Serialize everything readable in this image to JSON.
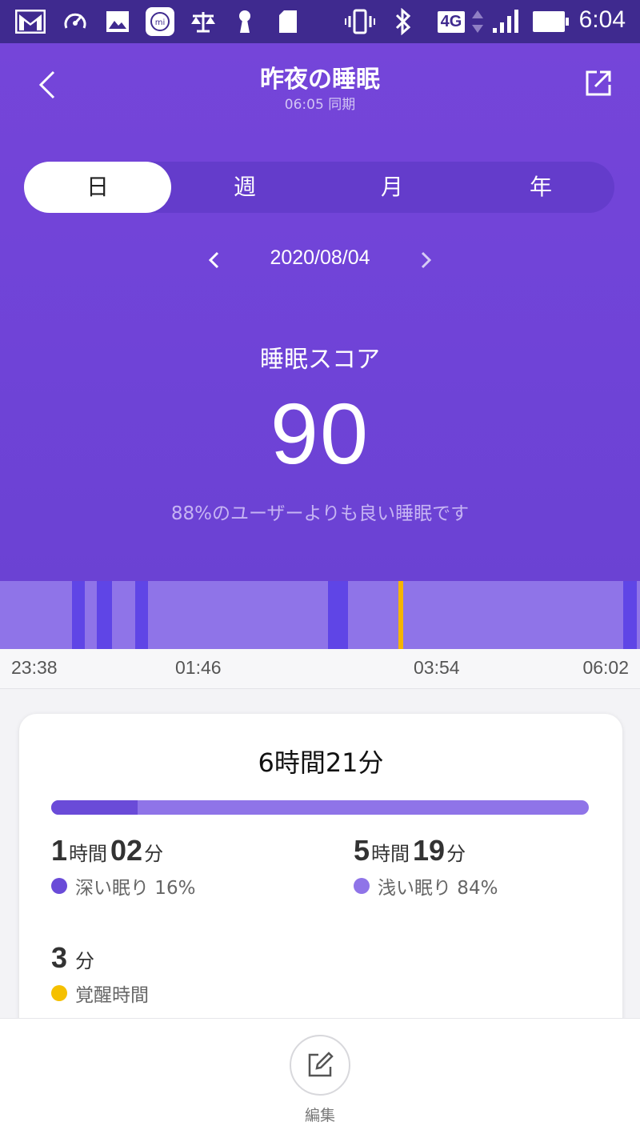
{
  "status_bar": {
    "time": "6:04",
    "network": "4G",
    "icons": [
      "gmail-icon",
      "speed-icon",
      "gallery-icon",
      "mi-fit-icon",
      "scale-icon",
      "keyhole-icon",
      "sd-card-icon",
      "vibrate-icon",
      "bluetooth-icon",
      "network-4g-icon",
      "signal-icon",
      "battery-icon"
    ]
  },
  "header": {
    "title": "昨夜の睡眠",
    "sync_text": "06:05 同期",
    "back_icon": "chevron-left-icon",
    "share_icon": "share-icon"
  },
  "tabs": [
    {
      "label": "日",
      "active": true
    },
    {
      "label": "週",
      "active": false
    },
    {
      "label": "月",
      "active": false
    },
    {
      "label": "年",
      "active": false
    }
  ],
  "date_nav": {
    "date": "2020/08/04",
    "prev_icon": "chevron-left-icon",
    "next_icon": "chevron-right-icon"
  },
  "score": {
    "label": "睡眠スコア",
    "value": "90",
    "compare": "88%のユーザーよりも良い睡眠です"
  },
  "timeline": {
    "start": "23:38",
    "end": "06:02",
    "ticks": [
      "23:38",
      "01:46",
      "03:54",
      "06:02"
    ],
    "segments": [
      {
        "type": "deep",
        "start": "00:21",
        "end": "00:29"
      },
      {
        "type": "deep",
        "start": "00:36",
        "end": "00:45"
      },
      {
        "type": "deep",
        "start": "00:59",
        "end": "01:07"
      },
      {
        "type": "deep",
        "start": "02:55",
        "end": "03:07"
      },
      {
        "type": "awake",
        "start": "03:37",
        "end": "03:40"
      },
      {
        "type": "deep",
        "start": "05:52",
        "end": "06:00"
      }
    ],
    "colors": {
      "light": "#8f74e8",
      "deep": "#5f45e6",
      "awake": "#f5b400"
    }
  },
  "summary": {
    "total": "6時間21分",
    "deep_fraction": 0.16,
    "deep": {
      "hours": "1",
      "hours_unit": "時間",
      "minutes": "02",
      "minutes_unit": "分",
      "label": "深い眠り 16%",
      "color": "#6a4bd8"
    },
    "light": {
      "hours": "5",
      "hours_unit": "時間",
      "minutes": "19",
      "minutes_unit": "分",
      "label": "浅い眠り 84%",
      "color": "#8f74e8"
    },
    "awake": {
      "minutes": "3",
      "minutes_unit": "分",
      "label": "覚醒時間",
      "color": "#f5c000"
    }
  },
  "bottom": {
    "edit_label": "編集",
    "edit_icon": "edit-icon"
  }
}
